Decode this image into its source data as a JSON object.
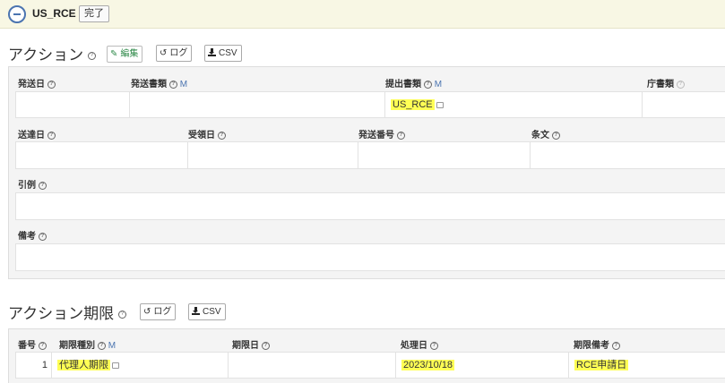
{
  "header": {
    "title": "US_RCE",
    "done_label": "完了"
  },
  "actions": {
    "title": "アクション",
    "edit_label": "編集",
    "log_label": "ログ",
    "csv_label": "CSV",
    "row1": {
      "send_date_label": "発送日",
      "send_doc_label": "発送書類",
      "submit_doc_label": "提出書類",
      "office_doc_label": "庁書類",
      "submit_doc_value": "US_RCE",
      "m_flag": "M"
    },
    "row2": {
      "delivery_date_label": "送達日",
      "receipt_date_label": "受領日",
      "send_number_label": "発送番号",
      "article_label": "条文"
    },
    "citation_label": "引例",
    "remarks_label": "備考"
  },
  "deadlines": {
    "title": "アクション期限",
    "log_label": "ログ",
    "csv_label": "CSV",
    "columns": {
      "number": "番号",
      "type": "期限種別",
      "deadline_date": "期限日",
      "processed_date": "処理日",
      "remarks": "期限備考"
    },
    "m_flag": "M",
    "rows": [
      {
        "number": "1",
        "type": "代理人期限",
        "deadline_date": "",
        "processed_date": "2023/10/18",
        "remarks": "RCE申請日"
      }
    ]
  },
  "colors": {
    "highlight": "#ffff55",
    "accent": "#4b74b0",
    "edit_green": "#2f8a4a"
  },
  "icons": [
    "collapse-icon",
    "help-icon",
    "edit-icon",
    "history-icon",
    "download-icon",
    "copy-icon"
  ]
}
